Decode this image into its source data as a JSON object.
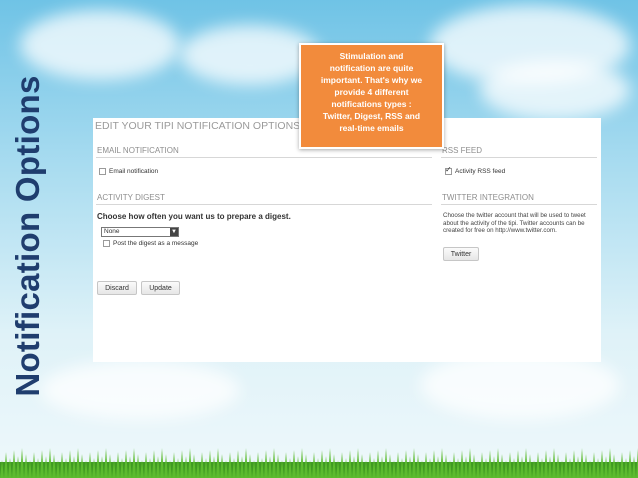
{
  "slide": {
    "side_title": "Notification Options"
  },
  "panel": {
    "title": "EDIT YOUR TIPI NOTIFICATION OPTIONS",
    "email": {
      "heading": "EMAIL NOTIFICATION",
      "checkbox_label": "Email notification",
      "checked": false
    },
    "digest": {
      "heading": "ACTIVITY DIGEST",
      "question": "Choose how often you want us to prepare a digest.",
      "select_value": "None",
      "post_checkbox_label": "Post the digest as a message",
      "post_checked": false
    },
    "buttons": {
      "discard": "Discard",
      "update": "Update"
    },
    "rss": {
      "heading": "RSS FEED",
      "checkbox_label": "Activity RSS feed",
      "checked": true
    },
    "twitter": {
      "heading": "TWITTER INTEGRATION",
      "description": "Choose the twitter account that will be used to tweet about the activity of the tipi. Twitter accounts can be created for free on http://www.twitter.com.",
      "button": "Twitter"
    }
  },
  "callout": {
    "text_lines": [
      "Stimulation and",
      "notification are quite",
      "important. That's why we",
      "provide 4 different",
      "notifications types :",
      "Twitter, Digest, RSS and",
      "real-time emails"
    ],
    "color": "#f28b3c"
  },
  "colors": {
    "title": "#1f3d6e",
    "sky_top": "#6fc3e6",
    "grass": "#4caa2a"
  }
}
